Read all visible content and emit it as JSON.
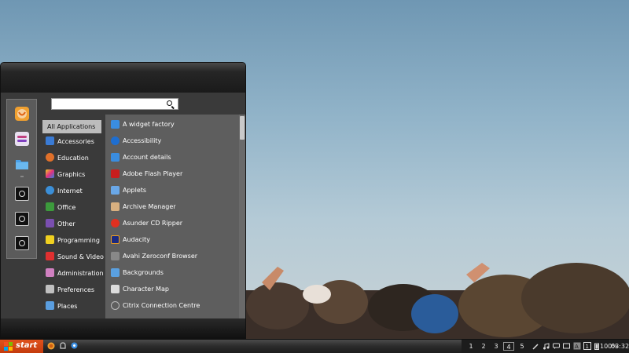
{
  "search": {
    "placeholder": ""
  },
  "favorites": [
    {
      "name": "firefox-icon"
    },
    {
      "name": "settings-icon"
    },
    {
      "name": "folder-icon"
    },
    {
      "name": "terminal-icon"
    },
    {
      "name": "terminal-icon"
    },
    {
      "name": "terminal-icon"
    }
  ],
  "categories": [
    {
      "label": "All Applications",
      "icon": "none",
      "color": ""
    },
    {
      "label": "Accessories",
      "icon": "accessories-icon",
      "color": "#3a7bd5"
    },
    {
      "label": "Education",
      "icon": "education-icon",
      "color": "#e0702a"
    },
    {
      "label": "Graphics",
      "icon": "graphics-icon",
      "color": "#d94fb0"
    },
    {
      "label": "Internet",
      "icon": "internet-icon",
      "color": "#3b8fd8"
    },
    {
      "label": "Office",
      "icon": "office-icon",
      "color": "#3c9a3c"
    },
    {
      "label": "Other",
      "icon": "other-icon",
      "color": "#7a4fb0"
    },
    {
      "label": "Programming",
      "icon": "programming-icon",
      "color": "#f0d020"
    },
    {
      "label": "Sound & Video",
      "icon": "sound-video-icon",
      "color": "#e03030"
    },
    {
      "label": "Administration",
      "icon": "administration-icon",
      "color": "#d080c0"
    },
    {
      "label": "Preferences",
      "icon": "preferences-icon",
      "color": "#c0c0c0"
    },
    {
      "label": "Places",
      "icon": "places-icon",
      "color": "#5a9ee0"
    }
  ],
  "applications": [
    {
      "label": "A widget factory",
      "icon": "widget-factory-icon",
      "color": "#3a8de0"
    },
    {
      "label": "Accessibility",
      "icon": "accessibility-icon",
      "color": "#1e6ed0"
    },
    {
      "label": "Account details",
      "icon": "account-details-icon",
      "color": "#3a8de0"
    },
    {
      "label": "Adobe Flash Player",
      "icon": "flash-player-icon",
      "color": "#c81e1e"
    },
    {
      "label": "Applets",
      "icon": "applets-icon",
      "color": "#6aa8e8"
    },
    {
      "label": "Archive Manager",
      "icon": "archive-manager-icon",
      "color": "#d8b080"
    },
    {
      "label": "Asunder CD Ripper",
      "icon": "cd-ripper-icon",
      "color": "#e03020"
    },
    {
      "label": "Audacity",
      "icon": "audacity-icon",
      "color": "#f0a020"
    },
    {
      "label": "Avahi Zeroconf Browser",
      "icon": "avahi-icon",
      "color": "#888888"
    },
    {
      "label": "Backgrounds",
      "icon": "backgrounds-icon",
      "color": "#5aa0e0"
    },
    {
      "label": "Character Map",
      "icon": "character-map-icon",
      "color": "#dddddd"
    },
    {
      "label": "Citrix Connection Centre",
      "icon": "citrix-icon",
      "color": "#bbbbbb"
    }
  ],
  "taskbar": {
    "start_label": "start",
    "workspaces": [
      "1",
      "2",
      "3",
      "4",
      "5"
    ],
    "current_workspace": "4",
    "battery": "100%",
    "clock": "03:32"
  }
}
